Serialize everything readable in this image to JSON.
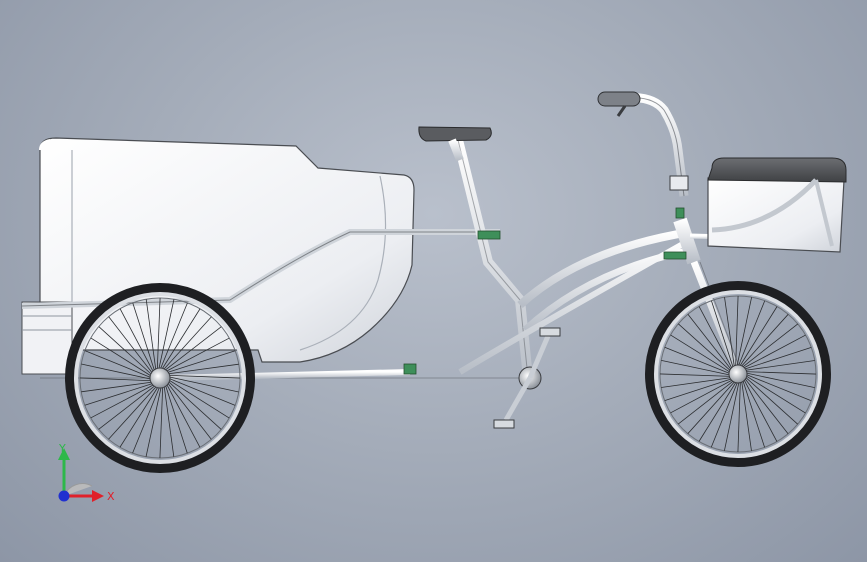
{
  "viewport": {
    "background_top": "#b9c0cc",
    "background_bottom": "#8d96a6"
  },
  "model": {
    "parts": [
      "cargo-box",
      "rear-wheel",
      "front-wheel",
      "frame",
      "seat",
      "handlebar",
      "front-basket",
      "crank",
      "pedal",
      "fork"
    ],
    "colors": {
      "body_white": "#f4f5f7",
      "tube_gray": "#cfd4da",
      "tire": "#1e1f22",
      "rim": "#d8dbe0",
      "clamp_green": "#3e8f5a",
      "basket_lid": "#5b5d61",
      "edge": "#4a4d52"
    }
  },
  "triad": {
    "y_label": "Y",
    "x_label": "X",
    "y_color": "#2db84a",
    "x_color": "#e0202a",
    "z_color": "#2030d0"
  }
}
